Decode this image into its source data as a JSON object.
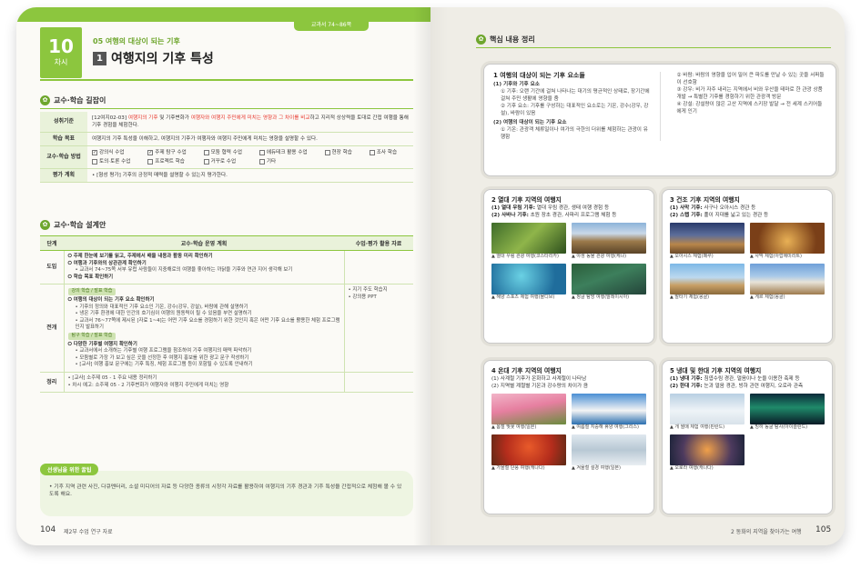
{
  "left": {
    "top_tab": "교과서 74~86쪽",
    "lesson": {
      "number": "10",
      "unit": "차시"
    },
    "subheading": "05 여행의 대상이 되는 기후",
    "title_num": "1",
    "title": "여행지의 기후 특성",
    "section1": "교수·학습 길잡이",
    "goals": {
      "standard_label": "성취기준",
      "standard_pre": "[12여지02-03] ",
      "standard_hl1": "여행지의 기후",
      "standard_mid1": " 및 기후변화가 ",
      "standard_hl2": "여행자와 여행지 주민에게 미치는 영향과 그 차이를 비교",
      "standard_post": "하고 지리적 상상력을 토대로 간접 여행을 통해 기후 경험을 체험한다.",
      "goal_label": "학습 목표",
      "goal_text": "여행지의 기후 특성을 이해하고, 여행지의 기후가 여행자와 여행지 주민에게 미치는 영향을 설명할 수 있다.",
      "method_label": "교수·학습 방법",
      "methods": [
        {
          "label": "강의식 수업",
          "checked": true
        },
        {
          "label": "주제 탐구 수업",
          "checked": true
        },
        {
          "label": "모둠 협력 수업",
          "checked": false
        },
        {
          "label": "에듀테크 활용 수업",
          "checked": false
        },
        {
          "label": "현장 학습",
          "checked": false
        },
        {
          "label": "조사 학습",
          "checked": false
        },
        {
          "label": "토의·토론 수업",
          "checked": false
        },
        {
          "label": "프로젝트 학습",
          "checked": false
        },
        {
          "label": "거꾸로 수업",
          "checked": false
        },
        {
          "label": "기타",
          "checked": false
        }
      ],
      "eval_label": "평가 계획",
      "eval_text": "• [형성 평가] 기후의 긍정적 매력을 설명할 수 있는지 평가한다."
    },
    "section2": "교수·학습 설계안",
    "plan": {
      "headers": [
        "단계",
        "교수·학습 운영 계획",
        "수업·평가 활용 자료"
      ],
      "intro_stage": "도입",
      "intro_q1": "주제 한눈에 보기를 읽고, 주제에서 배울 내용과 활동 미리 확인하기",
      "intro_q2": "여행과 기후와의 상관관계 확인하기",
      "intro_q2_sub": "• 교과서 74~75쪽 서부 유럽 사람들이 지중해로의 여행을 좋아하는 까닭을 기후와 연관 지어 생각해 보기",
      "intro_q3": "학습 목표 확인하기",
      "dev_stage": "전개",
      "dev_tag1": "강의 학습 / 발표 학습",
      "dev_q1": "여행의 대상이 되는 기후 요소 확인하기",
      "dev_q1_items": [
        "• 기후의 정의와 대표적인 기후 요소인 기온, 강수(강우, 강설), 바람에 관해 설명하기",
        "• 냉온 기후 환경에 대한 인간의 호기심이 여행의 원동력이 될 수 있음을 부연 설명하기",
        "• 교과서 76~77쪽에 제시된 [자료 1~4]는 어떤 기후 요소를 경험하기 위한 것인지 혹은 어떤 기후 요소를 활용한 체험 프로그램인지 발표하기"
      ],
      "dev_tag2": "탐구 학습 / 발표 학습",
      "dev_q2": "다양한 기후별 여행지 확인하기",
      "dev_q2_items": [
        "• 교과서에서 소개하는 기후별 여행 프로그램을 참조하여 기후 여행지의 매력 파악하기",
        "• 모둠별로 가장 가 보고 싶은 곳을 선정한 후 여행지 홍보를 위한 광고 문구 작성하기",
        "• [교사] 여행 홍보 문구에는 기후 특징, 체험 프로그램 등이 포함될 수 있도록 안내하기"
      ],
      "dev_res": [
        "• 지기 주도 학습지",
        "• 강의용 PPT"
      ],
      "close_stage": "정리",
      "close_items": [
        "• [교사] 소주제 05 - 1 주요 내용 정리하기",
        "• 차시 예고: 소주제 05 - 2 기후변화가 여행자와 여행지 주민에게 미치는 영향"
      ]
    },
    "tip_tag": "선생님을 위한 꿀팁",
    "tip_text": "• 기후 지역 관련 사진, 다큐멘터리, 소셜 미디어의 자료 등 다양한 종류의 시청각 자료를 활용하여 여행지의 기후 경관과 기후 특성을 간접적으로 체험해 볼 수 있도록 해요.",
    "folio": "104",
    "folio_text": "제2부 수업 연구 자료"
  },
  "right": {
    "heading": "핵심 내용 정리",
    "summary": {
      "title": "1 여행의 대상이 되는 기후 요소들",
      "s1": "(1) 기후와 기후 요소",
      "s1_items": [
        "① 기후: 오랜 기간에 걸쳐 나타나는 대기의 평균적인 상태로, 장기간에 걸쳐 주민 생활에 영향을 줌",
        "② 기후 요소: 기후를 구성하는 대표적인 요소로는 기온, 강수(강우, 강설), 바람이 있음"
      ],
      "s2": "(2) 여행의 대상이 되는 기후 요소",
      "s2_items": [
        "① 기온: 관광객 체류일이나 여가의 극한의 더위를 체험하는 관광이 유행함"
      ],
      "right_items": [
        "② 바람: 바람의 영향을 입어 밀어 큰 파도를 만날 수 있는 곳을 서퍼들이 선호함",
        "③ 강우: 비가 자주 내리는 지역에서 비와 우산을 테마로 한 관광 상품 개발 → 특별한 기후를 경험하기 위한 관광객 방문",
        "④ 강설: 강설량이 많은 고산 지역에 스키장 발달 → 전 세계 스키어들에게 인기"
      ]
    },
    "zones": [
      {
        "title": "2 열대 기후 지역의 여행지",
        "lines": [
          {
            "bold": "(1) 열대 우림 기후:",
            "text": " 열대 우림 경관, 생태 여행 경험 등"
          },
          {
            "bold": "(2) 사바나 기후:",
            "text": " 초원 장초 경관, 사파리 프로그램 체험 등"
          }
        ],
        "photos": [
          {
            "cls": "p-jungle",
            "caption": "▲ 열대 우림 관광 여행(코스타리카)",
            "name": "rainforest-photo"
          },
          {
            "cls": "p-savanna",
            "caption": "▲ 야생 동물 관광 여행(케냐)",
            "name": "savanna-photo"
          },
          {
            "cls": "p-reef",
            "caption": "▲ 해양 스포츠 체험 여행(몰디브)",
            "name": "reef-photo"
          },
          {
            "cls": "p-canoe",
            "caption": "▲ 정글 탐방 여행(말레이시아)",
            "name": "canoe-photo"
          }
        ]
      },
      {
        "title": "3 건조 기후 지역의 여행지",
        "lines": [
          {
            "bold": "(1) 사막 기후:",
            "text": " 사구나 오아시스 경관 등"
          },
          {
            "bold": "(2) 스텝 기후:",
            "text": " 풀이 지대를 넓고 있는 경관 등"
          }
        ],
        "photos": [
          {
            "cls": "p-oasis",
            "caption": "▲ 오아시스 체험(페루)",
            "name": "oasis-photo"
          },
          {
            "cls": "p-tent",
            "caption": "▲ 사막 체험(아랍에미리트)",
            "name": "desert-tent-photo"
          },
          {
            "cls": "p-camel",
            "caption": "▲ 말타기 체험(몽골)",
            "name": "horse-photo"
          },
          {
            "cls": "p-ger",
            "caption": "▲ 게르 체험(몽골)",
            "name": "ger-photo"
          }
        ]
      },
      {
        "title": "4 온대 기후 지역의 여행지",
        "lines": [
          {
            "bold": "",
            "text": "(1) 사계절 기후가 온화하고 사계절이 나타남"
          },
          {
            "bold": "",
            "text": "(2) 지역별 계절별 기온과 강수량의 차이가 큼"
          }
        ],
        "photos": [
          {
            "cls": "p-blossom",
            "caption": "▲ 봄철 벚꽃 여행(일본)",
            "name": "cherry-blossom-photo"
          },
          {
            "cls": "p-santorini",
            "caption": "▲ 여름철 지중해 휴양 여행(그리스)",
            "name": "santorini-photo"
          },
          {
            "cls": "p-maple",
            "caption": "▲ 가을철 단풍 여행(캐나다)",
            "name": "maple-photo"
          },
          {
            "cls": "p-train",
            "caption": "▲ 겨울철 설경 여행(일본)",
            "name": "snow-train-photo"
          }
        ]
      },
      {
        "title": "5 냉대 및 한대 기후 지역의 여행지",
        "lines": [
          {
            "bold": "(1) 냉대 기후:",
            "text": " 침엽수림 경관, 얼음이나 눈을 이용한 축제 등"
          },
          {
            "bold": "(2) 한대 기후:",
            "text": " 눈과 얼음 경관, 빙하 관련 여행지, 오로라 관측"
          }
        ],
        "photos": [
          {
            "cls": "p-husky",
            "caption": "▲ 개 썰매 체험 여행(핀란드)",
            "name": "husky-photo"
          },
          {
            "cls": "p-aurora",
            "caption": "▲ 빙하 동굴 탐사(아이슬란드)",
            "name": "ice-cave-photo"
          },
          {
            "cls": "p-ice",
            "caption": "▲ 오로라 여행(캐나다)",
            "name": "aurora-photo"
          }
        ]
      }
    ],
    "folio": "105",
    "folio_text": "2 동화의 지역을 찾아가는 여행"
  }
}
